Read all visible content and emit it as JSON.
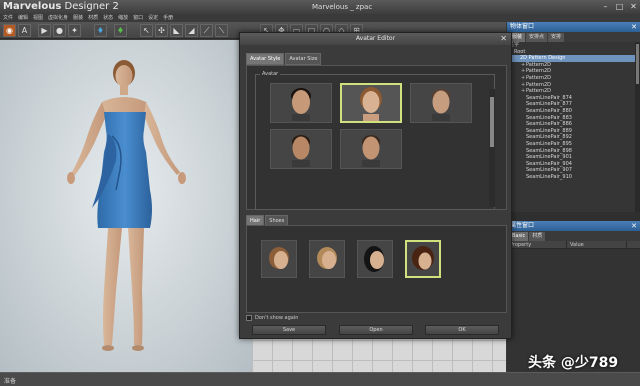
{
  "app": {
    "logo_bold": "Marvelous",
    "logo_rest": " Designer 2",
    "doc_title": "Marvelous _ zpac",
    "minimize": "–",
    "maximize": "□",
    "close": "✕"
  },
  "menu": [
    "文件",
    "编辑",
    "视图",
    "虚拟化身",
    "服装",
    "材质",
    "状态",
    "缩放",
    "窗口",
    "设定",
    "手册"
  ],
  "object_panel": {
    "title": "物体窗口",
    "tabs": [
      "服装",
      "安排点",
      "安排"
    ],
    "tree_header": "名字",
    "rows": [
      {
        "label": "Root",
        "indent": 0,
        "exp": ""
      },
      {
        "label": "2D Pattern Design",
        "indent": 1,
        "exp": "-"
      },
      {
        "label": "Pattern2D",
        "indent": 2,
        "exp": "+"
      },
      {
        "label": "Pattern2D",
        "indent": 2,
        "exp": "+"
      },
      {
        "label": "Pattern2D",
        "indent": 2,
        "exp": "+"
      },
      {
        "label": "Pattern2D",
        "indent": 2,
        "exp": "+"
      },
      {
        "label": "Pattern2D",
        "indent": 2,
        "exp": "+"
      },
      {
        "label": "SeamLinePair_874",
        "indent": 2,
        "exp": ""
      },
      {
        "label": "SeamLinePair_877",
        "indent": 2,
        "exp": ""
      },
      {
        "label": "SeamLinePair_880",
        "indent": 2,
        "exp": ""
      },
      {
        "label": "SeamLinePair_883",
        "indent": 2,
        "exp": ""
      },
      {
        "label": "SeamLinePair_886",
        "indent": 2,
        "exp": ""
      },
      {
        "label": "SeamLinePair_889",
        "indent": 2,
        "exp": ""
      },
      {
        "label": "SeamLinePair_892",
        "indent": 2,
        "exp": ""
      },
      {
        "label": "SeamLinePair_895",
        "indent": 2,
        "exp": ""
      },
      {
        "label": "SeamLinePair_898",
        "indent": 2,
        "exp": ""
      },
      {
        "label": "SeamLinePair_901",
        "indent": 2,
        "exp": ""
      },
      {
        "label": "SeamLinePair_904",
        "indent": 2,
        "exp": ""
      },
      {
        "label": "SeamLinePair_907",
        "indent": 2,
        "exp": ""
      },
      {
        "label": "SeamLinePair_910",
        "indent": 2,
        "exp": ""
      }
    ]
  },
  "property_panel": {
    "title": "属性窗口",
    "tabs": [
      "Basic",
      "材质"
    ],
    "col_property": "Property",
    "col_value": "Value"
  },
  "dialog": {
    "title": "Avatar Editor",
    "tabs": [
      "Avatar Style",
      "Avatar Size"
    ],
    "group_label": "Avatar",
    "hair_tabs": [
      "Hair",
      "Shoes"
    ],
    "dont_show": "Don't show again",
    "buttons": [
      "Save",
      "Open",
      "OK"
    ]
  },
  "status": {
    "text": "准备"
  },
  "watermark": "头条 @少789",
  "colors": {
    "accent_blue": "#3f76b0",
    "dress_blue": "#3a7ec0",
    "selection_border": "#cfe27e"
  }
}
